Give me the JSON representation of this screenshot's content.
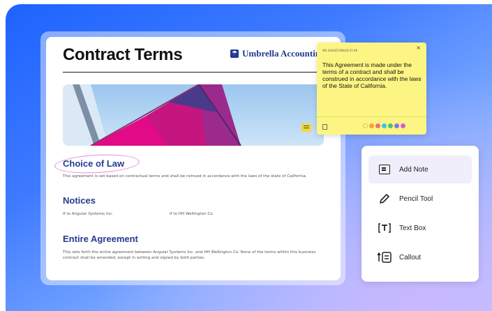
{
  "document": {
    "title": "Contract Terms",
    "brand": "Umbrella Accounting",
    "sections": [
      {
        "heading": "Choice of Law",
        "body": "This agreement is set based on contractual terms and shall be nstrued in accordance with the laws of the state of California."
      },
      {
        "heading": "Notices",
        "left": "If to Angular Systems Inc.",
        "right": "If to HH Wellington Co."
      },
      {
        "heading": "Entire Agreement",
        "body": "This sets forth the entire agreement between Angular Systems Inc. and HH Wellington Co. None of the terms within this business contract shall be amended, except in writing and signed by both parties."
      }
    ]
  },
  "sticky_note": {
    "meta": "WS 2024/07/08/16:57:49",
    "text": "This Agreement is made under the terms of a contract and shall be construed in accordance with the laws of the State of California.",
    "close": "×",
    "swatch_colors": [
      "#fdf583",
      "#f7a23b",
      "#f26b7a",
      "#39c4e6",
      "#47c46f",
      "#8f6cf0",
      "#d35fd1"
    ]
  },
  "tools": [
    {
      "label": "Add Note",
      "icon": "note-icon",
      "active": true
    },
    {
      "label": "Pencil Tool",
      "icon": "pencil-icon",
      "active": false
    },
    {
      "label": "Text Box",
      "icon": "text-box-icon",
      "active": false
    },
    {
      "label": "Callout",
      "icon": "callout-icon",
      "active": false
    }
  ],
  "colors": {
    "background_blue": "#1e63ff",
    "heading_navy": "#253a8e",
    "note_yellow": "#fdf583",
    "highlight_pink": "#e28be0"
  }
}
